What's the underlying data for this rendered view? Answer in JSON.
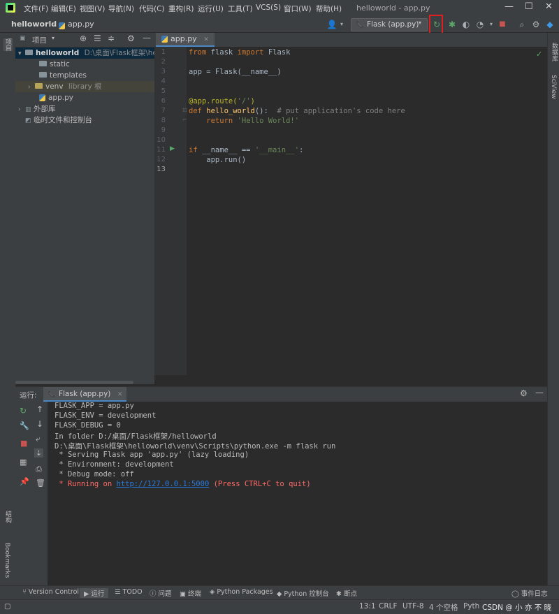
{
  "menubar": {
    "items": [
      "文件(F)",
      "编辑(E)",
      "视图(V)",
      "导航(N)",
      "代码(C)",
      "重构(R)",
      "运行(U)",
      "工具(T)",
      "VCS(S)",
      "窗口(W)",
      "帮助(H)"
    ],
    "window_title": "helloworld - app.py",
    "minimize": "—",
    "maximize": "☐",
    "close": "✕"
  },
  "navbar": {
    "project": "helloworld",
    "file": "app.py",
    "run_config": "Flask (app.py)",
    "run_config_icon": "flask-icon"
  },
  "left_strip": {
    "project_label": "项目",
    "structure_label": "结构",
    "bookmarks_label": "Bookmarks"
  },
  "right_strip": {
    "database_label": "数据库",
    "sciview_label": "SciView"
  },
  "project_panel": {
    "title": "项目",
    "tree": [
      {
        "label": "helloworld",
        "extra": "D:\\桌面\\Flask框架\\hello",
        "type": "folder",
        "indent": 0,
        "expanded": true
      },
      {
        "label": "static",
        "extra": "",
        "type": "folder",
        "indent": 2
      },
      {
        "label": "templates",
        "extra": "",
        "type": "folder",
        "indent": 2
      },
      {
        "label": "venv",
        "extra": "library 根",
        "type": "folder",
        "indent": 1,
        "expanded": false
      },
      {
        "label": "app.py",
        "extra": "",
        "type": "py",
        "indent": 2
      },
      {
        "label": "外部库",
        "extra": "",
        "type": "lib",
        "indent": 0,
        "expanded": false
      },
      {
        "label": "临时文件和控制台",
        "extra": "",
        "type": "scratch",
        "indent": 0
      }
    ]
  },
  "editor": {
    "tab": "app.py",
    "line_numbers": [
      "1",
      "2",
      "3",
      "4",
      "5",
      "6",
      "7",
      "8",
      "9",
      "10",
      "11",
      "12",
      "13"
    ],
    "lines": {
      "l1_kw1": "from",
      "l1_mod": " flask ",
      "l1_kw2": "import",
      "l1_name": " Flask",
      "l3": "app = Flask(__name__)",
      "l6_dec": "@app.route(",
      "l6_str": "'/'",
      "l6_end": ")",
      "l7_kw": "def ",
      "l7_fn": "hello_world",
      "l7_sig": "():  ",
      "l7_cm": "# put application's code here",
      "l8_kw": "    return ",
      "l8_str": "'Hello World!'",
      "l11_kw": "if ",
      "l11_mid": "__name__ == ",
      "l11_str": "'__main__'",
      "l11_end": ":",
      "l12": "    app.run()"
    }
  },
  "run_panel": {
    "label": "运行:",
    "tab": "Flask (app.py)",
    "output": [
      "FLASK_APP = app.py",
      "FLASK_ENV = development",
      "FLASK_DEBUG = 0",
      "In folder D:/桌面/Flask框架/helloworld",
      "D:\\桌面\\Flask框架\\helloworld\\venv\\Scripts\\python.exe -m flask run",
      " * Serving Flask app 'app.py' (lazy loading)",
      " * Environment: development",
      " * Debug mode: off"
    ],
    "running_prefix": " * Running on ",
    "running_url": "http://127.0.0.1:5000",
    "running_suffix": " (Press CTRL+C to quit)"
  },
  "toolbar": {
    "version_control": "Version Control",
    "run": "运行",
    "todo": "TODO",
    "problems": "问题",
    "terminal": "终端",
    "python_packages": "Python Packages",
    "python_console": "Python 控制台",
    "debug": "断点",
    "event_log": "事件日志"
  },
  "statusbar": {
    "position": "13:1",
    "line_sep": "CRLF",
    "encoding": "UTF-8",
    "indent": "4 个空格",
    "interpreter": "Pyth",
    "watermark": "CSDN @ 小 亦 不 晓"
  }
}
